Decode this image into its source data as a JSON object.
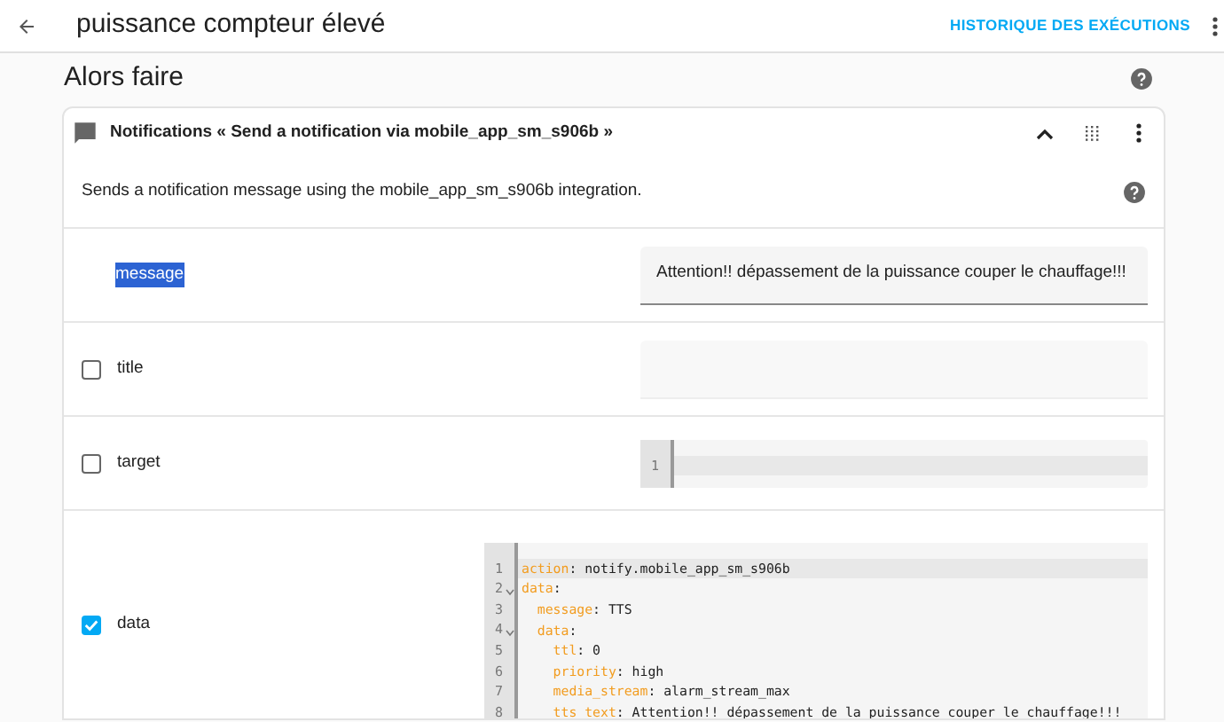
{
  "header": {
    "title": "puissance compteur élevé",
    "action": "HISTORIQUE DES EXÉCUTIONS"
  },
  "section": {
    "title": "Alors faire"
  },
  "card": {
    "title": "Notifications « Send a notification via mobile_app_sm_s906b »",
    "expanded": true,
    "description": "Sends a notification message using the mobile_app_sm_s906b integration.",
    "fields": [
      {
        "kind": "text",
        "label": "message",
        "label_selected": true,
        "value": "Attention!! dépassement de la puissance couper le chauffage!!!"
      },
      {
        "kind": "text",
        "label": "title",
        "label_selected": false,
        "checked": false
      },
      {
        "kind": "code",
        "label": "target",
        "label_selected": false,
        "checked": false,
        "lines": [
          {
            "number": "1",
            "fold": false,
            "active": true
          }
        ]
      },
      {
        "kind": "code",
        "label": "data",
        "label_selected": false,
        "checked": true,
        "lines": [
          {
            "number": "1",
            "key": "action",
            "rest": ": notify.mobile_app_sm_s906b",
            "fold": false,
            "active": true
          },
          {
            "number": "2",
            "key": "data",
            "rest": ":",
            "fold": true,
            "active": false
          },
          {
            "number": "3",
            "key": "  message",
            "rest": ": TTS",
            "fold": false,
            "active": false
          },
          {
            "number": "4",
            "key": "  data",
            "rest": ":",
            "fold": true,
            "active": false
          },
          {
            "number": "5",
            "key": "    ttl",
            "rest": ": 0",
            "fold": false,
            "active": false
          },
          {
            "number": "6",
            "key": "    priority",
            "rest": ": high",
            "fold": false,
            "active": false
          },
          {
            "number": "7",
            "key": "    media_stream",
            "rest": ": alarm_stream_max",
            "fold": false,
            "active": false
          },
          {
            "number": "8",
            "key": "    tts_text",
            "rest": ": Attention!! dépassement de la puissance couper le chauffage!!!",
            "fold": false,
            "active": false
          }
        ]
      }
    ]
  }
}
